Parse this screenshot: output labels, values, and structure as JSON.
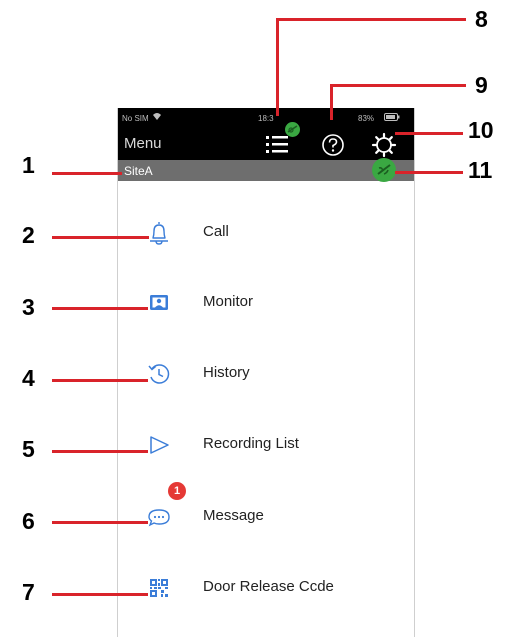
{
  "status_bar": {
    "carrier": "No SIM",
    "time": "18:3",
    "battery": "83%"
  },
  "header": {
    "title": "Menu"
  },
  "site": {
    "name": "SiteA"
  },
  "menu": {
    "items": [
      {
        "label": "Call",
        "icon": "bell-icon"
      },
      {
        "label": "Monitor",
        "icon": "monitor-icon"
      },
      {
        "label": "History",
        "icon": "history-icon"
      },
      {
        "label": "Recording List",
        "icon": "play-triangle-icon"
      },
      {
        "label": "Message",
        "icon": "chat-bubble-icon",
        "badge": "1"
      },
      {
        "label": "Door Release Ccde",
        "icon": "qr-code-icon"
      }
    ]
  },
  "callouts": [
    "1",
    "2",
    "3",
    "4",
    "5",
    "6",
    "7",
    "8",
    "9",
    "10",
    "11"
  ],
  "colors": {
    "accent_blue": "#3b7dd8",
    "callout_red": "#d9232a",
    "status_green": "#3aa842",
    "badge_red": "#e53935"
  }
}
